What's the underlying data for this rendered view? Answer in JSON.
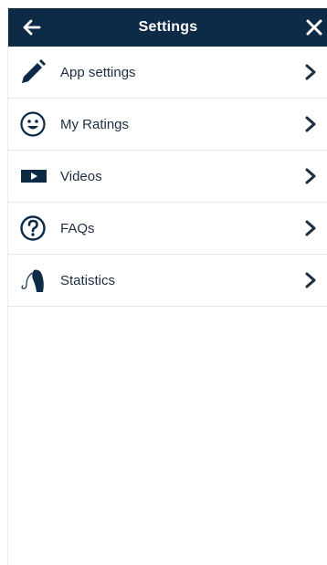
{
  "header": {
    "title": "Settings",
    "back_icon": "left-arrow-icon",
    "close_icon": "close-icon"
  },
  "menu": {
    "items": [
      {
        "label": "App settings",
        "icon": "pencil-icon"
      },
      {
        "label": "My Ratings",
        "icon": "smiley-icon"
      },
      {
        "label": "Videos",
        "icon": "video-play-icon"
      },
      {
        "label": "FAQs",
        "icon": "question-icon"
      },
      {
        "label": "Statistics",
        "icon": "hearing-aid-icon"
      }
    ],
    "chevron_icon": "chevron-right-icon"
  },
  "colors": {
    "header_bg": "#0d2a47",
    "text": "#1d2e40",
    "icon": "#0d2a47",
    "divider": "#e6e6e6"
  }
}
